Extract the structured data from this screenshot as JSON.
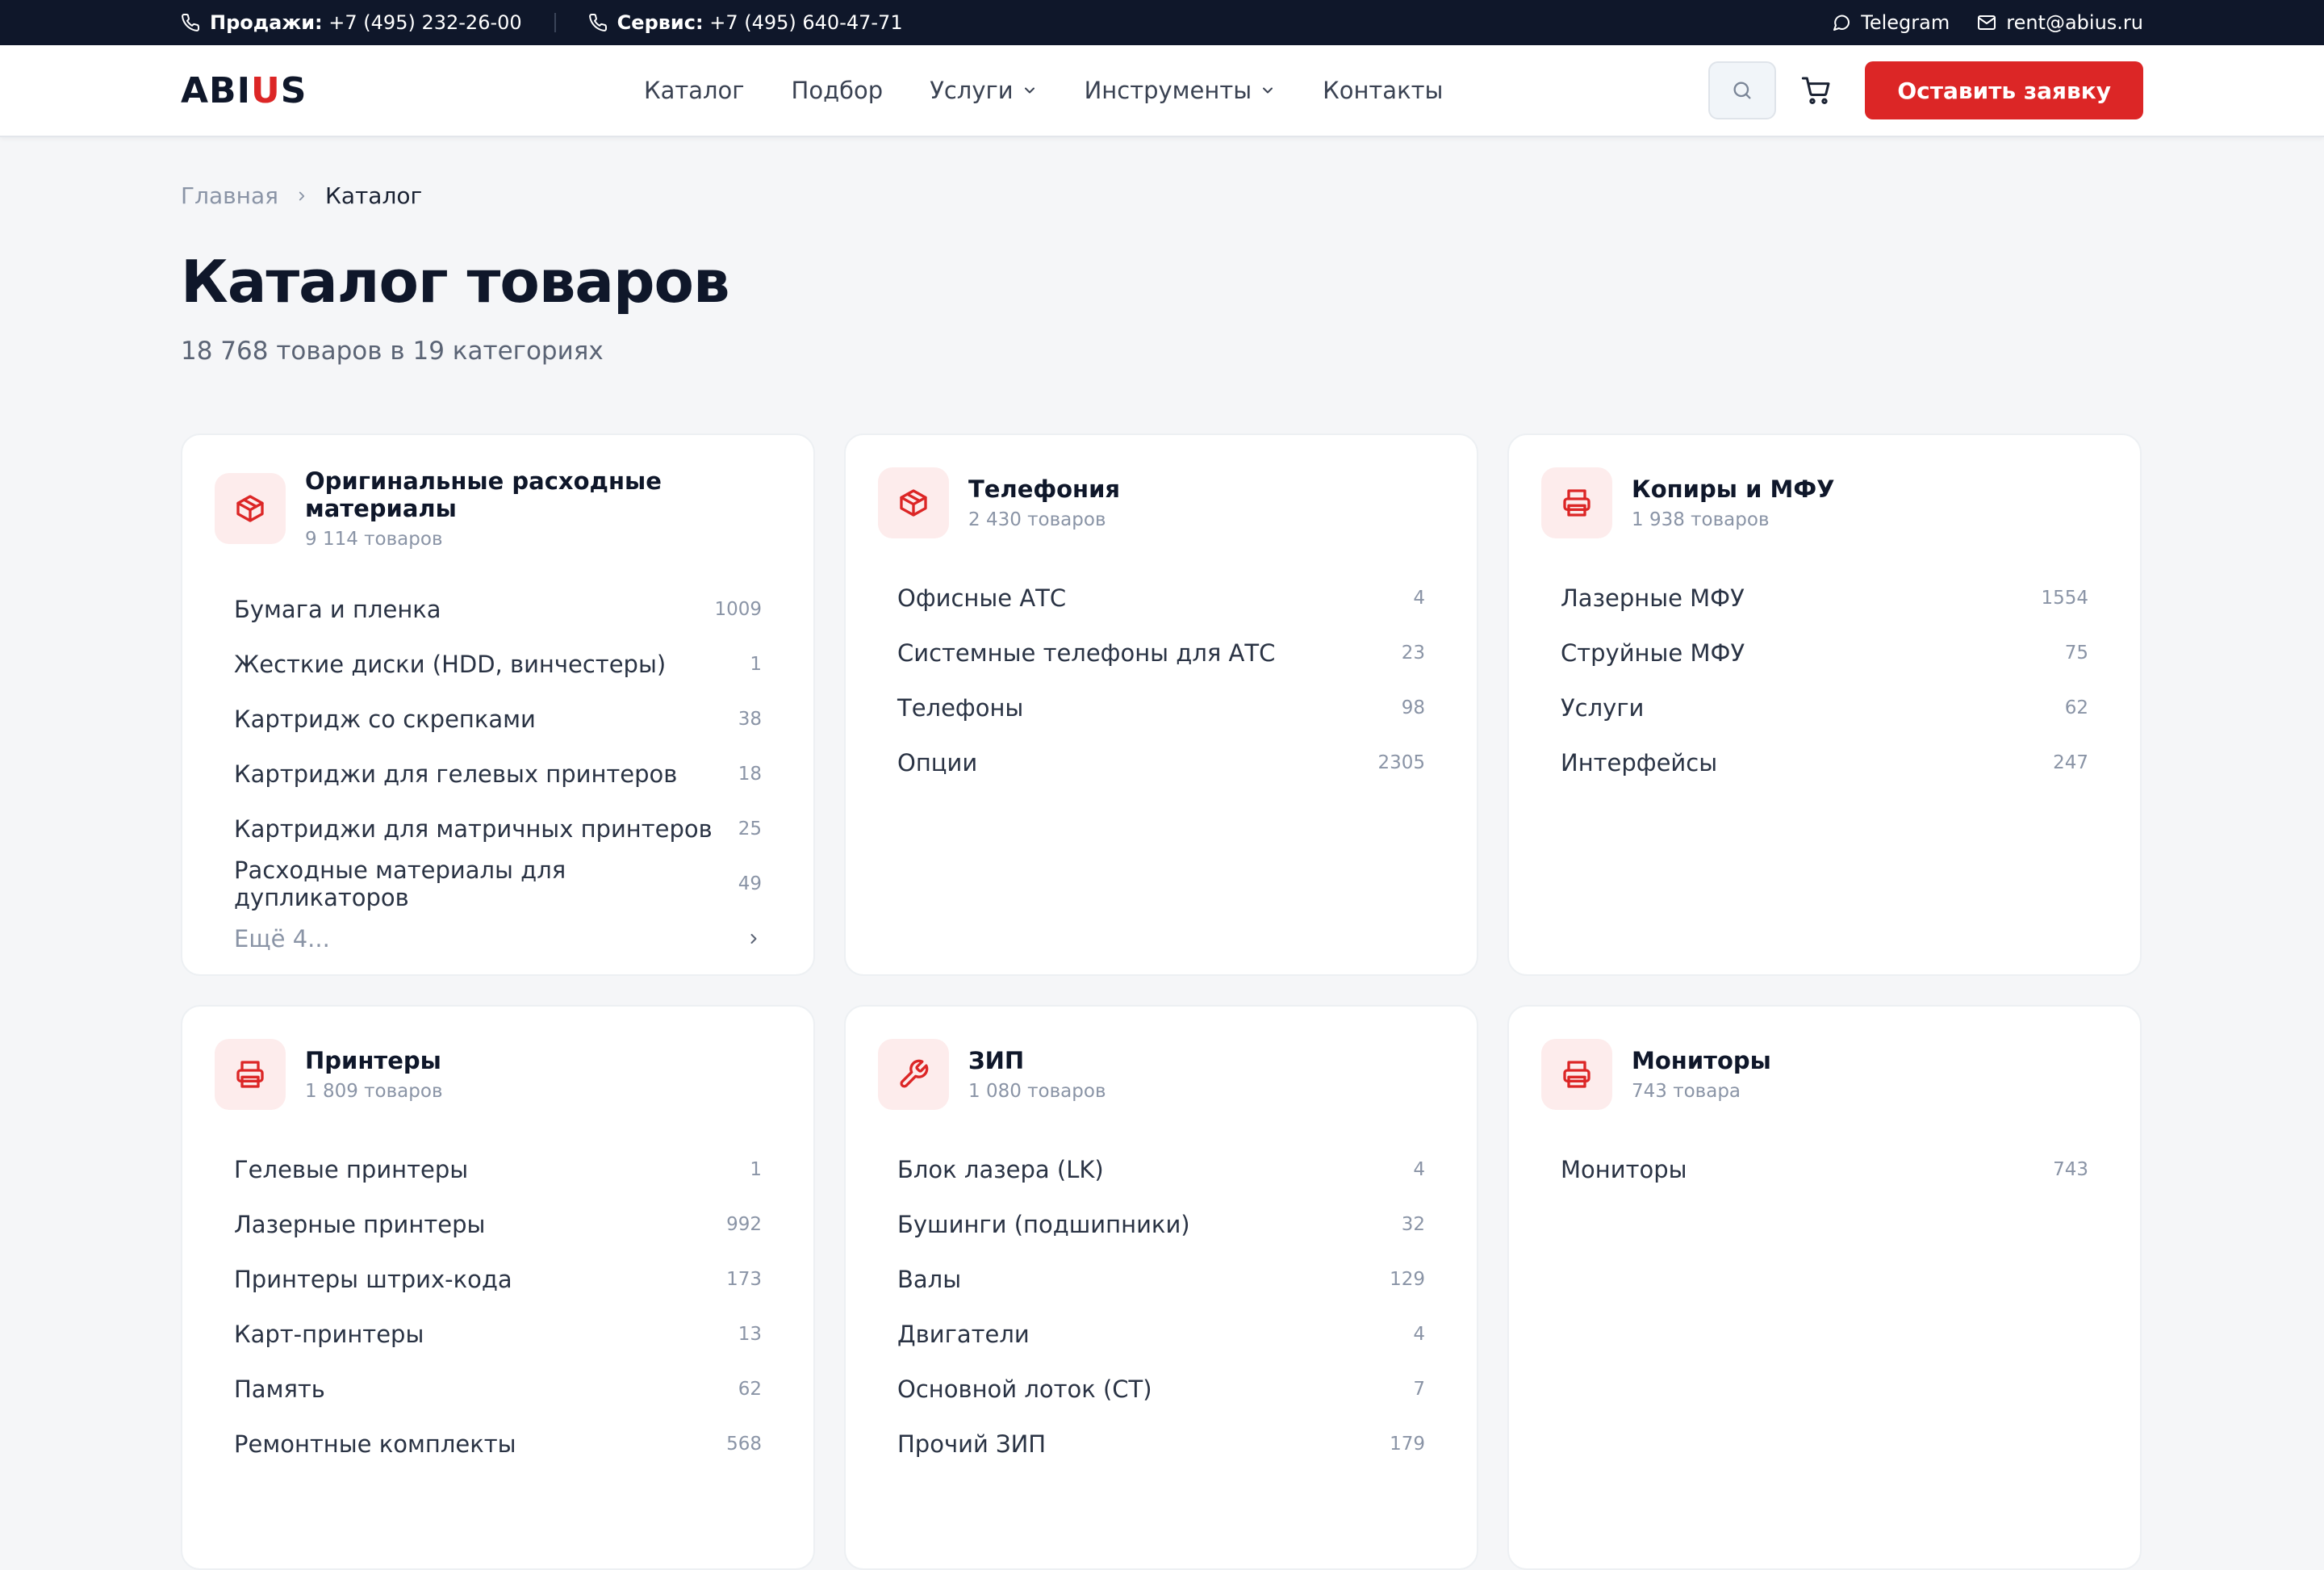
{
  "topbar": {
    "sales_label": "Продажи:",
    "sales_phone": "+7 (495) 232-26-00",
    "service_label": "Сервис:",
    "service_phone": "+7 (495) 640-47-71",
    "telegram": "Telegram",
    "email": "rent@abius.ru"
  },
  "header": {
    "logo_a": "ABI",
    "logo_u": "U",
    "logo_s": "S",
    "nav": [
      "Каталог",
      "Подбор",
      "Услуги",
      "Инструменты",
      "Контакты"
    ],
    "cta": "Оставить заявку"
  },
  "breadcrumb": {
    "home": "Главная",
    "current": "Каталог"
  },
  "page": {
    "title": "Каталог товаров",
    "subtitle": "18 768 товаров в 19 категориях"
  },
  "categories": [
    {
      "title": "Оригинальные расходные материалы",
      "count": "9 114 товаров",
      "icon": "box-icon",
      "items": [
        {
          "label": "Бумага и пленка",
          "num": "1009"
        },
        {
          "label": "Жесткие диски (HDD, винчестеры)",
          "num": "1"
        },
        {
          "label": "Картридж со скрепками",
          "num": "38"
        },
        {
          "label": "Картриджи для гелевых принтеров",
          "num": "18"
        },
        {
          "label": "Картриджи для матричных принтеров",
          "num": "25"
        },
        {
          "label": "Расходные материалы для дупликаторов",
          "num": "49"
        }
      ],
      "more": "Ещё 4..."
    },
    {
      "title": "Телефония",
      "count": "2 430 товаров",
      "icon": "box-icon",
      "items": [
        {
          "label": "Офисные АТС",
          "num": "4"
        },
        {
          "label": "Системные телефоны для АТС",
          "num": "23"
        },
        {
          "label": "Телефоны",
          "num": "98"
        },
        {
          "label": "Опции",
          "num": "2305"
        }
      ]
    },
    {
      "title": "Копиры и МФУ",
      "count": "1 938 товаров",
      "icon": "printer-icon",
      "items": [
        {
          "label": "Лазерные МФУ",
          "num": "1554"
        },
        {
          "label": "Струйные МФУ",
          "num": "75"
        },
        {
          "label": "Услуги",
          "num": "62"
        },
        {
          "label": "Интерфейсы",
          "num": "247"
        }
      ]
    },
    {
      "title": "Принтеры",
      "count": "1 809 товаров",
      "icon": "printer-icon",
      "items": [
        {
          "label": "Гелевые принтеры",
          "num": "1"
        },
        {
          "label": "Лазерные принтеры",
          "num": "992"
        },
        {
          "label": "Принтеры штрих-кода",
          "num": "173"
        },
        {
          "label": "Карт-принтеры",
          "num": "13"
        },
        {
          "label": "Память",
          "num": "62"
        },
        {
          "label": "Ремонтные комплекты",
          "num": "568"
        }
      ]
    },
    {
      "title": "ЗИП",
      "count": "1 080 товаров",
      "icon": "wrench-icon",
      "items": [
        {
          "label": "Блок лазера (LK)",
          "num": "4"
        },
        {
          "label": "Бушинги (подшипники)",
          "num": "32"
        },
        {
          "label": "Валы",
          "num": "129"
        },
        {
          "label": "Двигатели",
          "num": "4"
        },
        {
          "label": "Основной лоток (СТ)",
          "num": "7"
        },
        {
          "label": "Прочий ЗИП",
          "num": "179"
        }
      ]
    },
    {
      "title": "Мониторы",
      "count": "743 товара",
      "icon": "printer-icon",
      "items": [
        {
          "label": "Мониторы",
          "num": "743"
        }
      ]
    }
  ]
}
